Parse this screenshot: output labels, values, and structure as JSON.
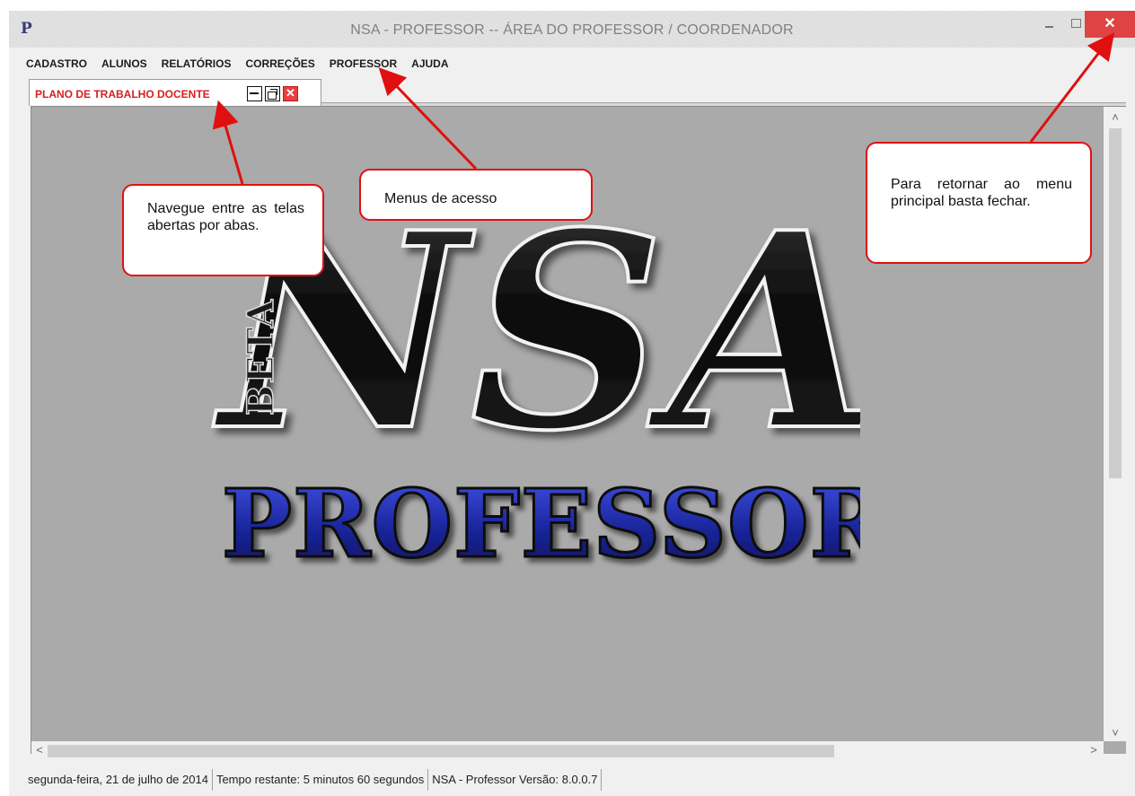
{
  "window": {
    "title": "NSA - PROFESSOR -- ÁREA DO PROFESSOR / COORDENADOR",
    "app_icon": "P",
    "close_glyph": "✕"
  },
  "menu": {
    "items": [
      {
        "label": "CADASTRO"
      },
      {
        "label": "ALUNOS"
      },
      {
        "label": "RELATÓRIOS"
      },
      {
        "label": "CORREÇÕES"
      },
      {
        "label": "PROFESSOR"
      },
      {
        "label": "AJUDA"
      }
    ]
  },
  "tabs": [
    {
      "label": "PLANO DE TRABALHO DOCENTE",
      "close_glyph": "✕"
    }
  ],
  "logo": {
    "main": "NSA",
    "sub": "PROFESSOR",
    "badge": "BETA"
  },
  "callouts": {
    "tabs_note": "Navegue entre as telas abertas por abas.",
    "menus_note": "Menus de acesso",
    "close_note": "Para retornar ao menu principal basta fechar."
  },
  "scroll": {
    "up": "˄",
    "down": "˅",
    "left": "<",
    "right": ">"
  },
  "status": {
    "date": "segunda-feira, 21 de julho de 2014",
    "time_left": "Tempo restante:  5  minutos  60  segundos",
    "version": "NSA - Professor   Versão: 8.0.0.7"
  },
  "colors": {
    "accent_red": "#e01010",
    "tab_label": "#d42020",
    "close_button": "#e04343",
    "logo_blue": "#1e2a9a",
    "content_bg": "#aaaaaa"
  }
}
